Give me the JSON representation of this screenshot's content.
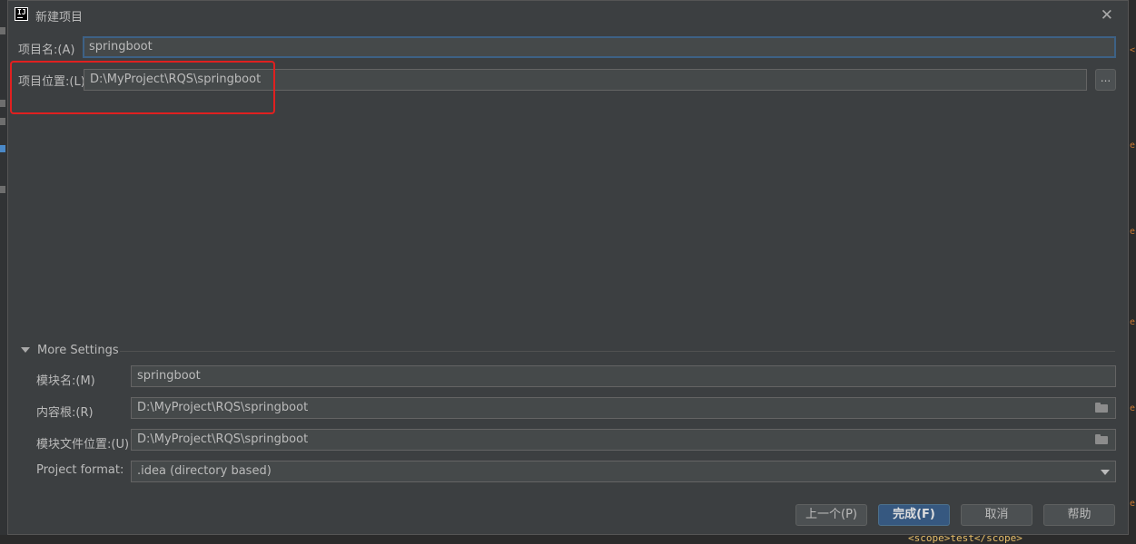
{
  "dialog": {
    "title": "新建项目",
    "app_icon_text": "IJ"
  },
  "fields": {
    "project_name": {
      "label": "项目名:(A)",
      "value": "springboot"
    },
    "project_location": {
      "label": "项目位置:(L)",
      "value": "D:\\MyProject\\RQS\\springboot",
      "browse_label": "..."
    }
  },
  "more_settings": {
    "label": "More Settings",
    "module_name": {
      "label": "模块名:(M)",
      "value": "springboot"
    },
    "content_root": {
      "label": "内容根:(R)",
      "value": "D:\\MyProject\\RQS\\springboot"
    },
    "module_file_location": {
      "label": "模块文件位置:(U)",
      "value": "D:\\MyProject\\RQS\\springboot"
    },
    "project_format": {
      "label": "Project format:",
      "value": ".idea (directory based)"
    }
  },
  "buttons": {
    "previous": "上一个(P)",
    "finish": "完成(F)",
    "cancel": "取消",
    "help": "帮助"
  },
  "background": {
    "bottom_code": "<scope>test</scope>"
  },
  "colors": {
    "dialog_bg": "#3c3f41",
    "field_bg": "#45494a",
    "focus_border": "#3d6185",
    "primary_button": "#365880",
    "highlight_box": "#e02020"
  }
}
